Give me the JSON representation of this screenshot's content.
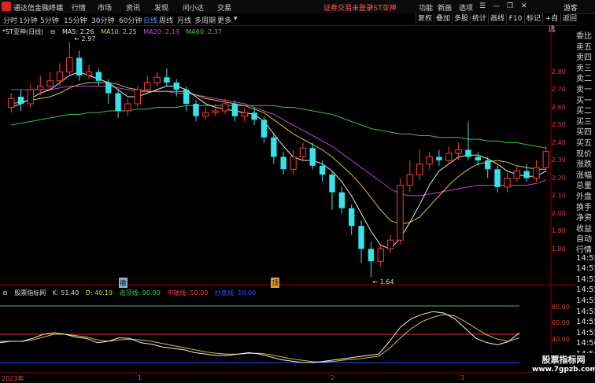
{
  "menubar": {
    "app_name": "通达信金融终端",
    "menus": [
      "行情",
      "市场",
      "资讯",
      "发现",
      "问小达",
      "交易"
    ],
    "warning": "证券交易未登录",
    "stock_tag": "*ST亚神",
    "right_menus": [
      "功能",
      "新画",
      "选项"
    ],
    "guest": "游客"
  },
  "periods": [
    "分时",
    "1分钟",
    "5分钟",
    "15分钟",
    "30分钟",
    "60分钟",
    "日线",
    "周线",
    "月线",
    "多周期",
    "更多"
  ],
  "active_period": "日线",
  "toolbar": [
    "复权",
    "叠加",
    "多股",
    "统计",
    "画线",
    "F10",
    "标记",
    "+自选",
    "返回"
  ],
  "main_chart": {
    "title": "*ST亚神(日线)",
    "ma5": "MA5: 2.26",
    "ma10": "MA10: 2.25",
    "ma20": "MA20: 2.19",
    "ma60": "MA60: 2.37",
    "high_label": "2.97",
    "low_label": "1.64",
    "signal_labels": [
      "撤",
      "顶"
    ]
  },
  "indicator": {
    "name": "股票指标网",
    "k": "K: 51.40",
    "d": "D: 40.19",
    "line1": "逃顶线: 90.00",
    "line2": "中轴线: 50.00",
    "line3": "抄底线: 10.00",
    "y_ticks": [
      "80.00",
      "60.00",
      "40.00"
    ]
  },
  "x_axis": [
    "2023年",
    "1",
    "2",
    "3"
  ],
  "side_panel": [
    "委比",
    "卖五",
    "卖四",
    "卖三",
    "卖二",
    "卖一",
    "买一",
    "买二",
    "买三",
    "买四",
    "买五",
    "现价",
    "涨跌",
    "涨幅",
    "总量",
    "外盘",
    "换手",
    "净资",
    "收益",
    "自动",
    "行情",
    "14:55",
    "14:55",
    "14:55",
    "14:55",
    "14:55",
    "14:55",
    "14:55",
    "14:55",
    "14:56",
    "14:56",
    "14:56",
    "14:56"
  ],
  "watermark": {
    "line1": "股票指标网",
    "line2": "www.7gpzb.com"
  },
  "chart_data": {
    "type": "candlestick",
    "y_ticks": [
      2.8,
      2.7,
      2.6,
      2.5,
      2.4,
      2.3,
      2.2,
      2.1,
      2.0,
      1.9,
      1.8
    ],
    "ylim": [
      1.62,
      3.02
    ],
    "candles": [
      [
        2.6,
        2.65,
        2.68,
        2.57
      ],
      [
        2.66,
        2.62,
        2.7,
        2.58
      ],
      [
        2.62,
        2.7,
        2.73,
        2.6
      ],
      [
        2.7,
        2.72,
        2.78,
        2.67
      ],
      [
        2.72,
        2.75,
        2.8,
        2.7
      ],
      [
        2.75,
        2.8,
        2.85,
        2.72
      ],
      [
        2.8,
        2.88,
        2.97,
        2.78
      ],
      [
        2.88,
        2.78,
        2.92,
        2.75
      ],
      [
        2.78,
        2.8,
        2.84,
        2.76
      ],
      [
        2.8,
        2.75,
        2.82,
        2.72
      ],
      [
        2.74,
        2.68,
        2.76,
        2.62
      ],
      [
        2.68,
        2.58,
        2.7,
        2.54
      ],
      [
        2.58,
        2.62,
        2.65,
        2.55
      ],
      [
        2.62,
        2.7,
        2.72,
        2.6
      ],
      [
        2.7,
        2.74,
        2.78,
        2.68
      ],
      [
        2.74,
        2.77,
        2.8,
        2.72
      ],
      [
        2.77,
        2.74,
        2.82,
        2.72
      ],
      [
        2.74,
        2.7,
        2.76,
        2.66
      ],
      [
        2.7,
        2.62,
        2.72,
        2.58
      ],
      [
        2.62,
        2.55,
        2.64,
        2.52
      ],
      [
        2.55,
        2.57,
        2.6,
        2.53
      ],
      [
        2.57,
        2.58,
        2.62,
        2.55
      ],
      [
        2.58,
        2.62,
        2.65,
        2.56
      ],
      [
        2.62,
        2.55,
        2.64,
        2.52
      ],
      [
        2.55,
        2.57,
        2.6,
        2.52
      ],
      [
        2.57,
        2.53,
        2.6,
        2.5
      ],
      [
        2.53,
        2.43,
        2.55,
        2.4
      ],
      [
        2.43,
        2.32,
        2.45,
        2.28
      ],
      [
        2.32,
        2.25,
        2.35,
        2.22
      ],
      [
        2.25,
        2.32,
        2.36,
        2.22
      ],
      [
        2.32,
        2.37,
        2.4,
        2.3
      ],
      [
        2.37,
        2.27,
        2.4,
        2.25
      ],
      [
        2.27,
        2.22,
        2.3,
        2.18
      ],
      [
        2.22,
        2.12,
        2.24,
        2.02
      ],
      [
        2.12,
        2.03,
        2.15,
        2.0
      ],
      [
        2.03,
        1.93,
        2.05,
        1.88
      ],
      [
        1.93,
        1.8,
        1.96,
        1.72
      ],
      [
        1.8,
        1.73,
        1.84,
        1.64
      ],
      [
        1.73,
        1.8,
        1.83,
        1.7
      ],
      [
        1.8,
        1.85,
        1.88,
        1.78
      ],
      [
        1.85,
        2.16,
        2.2,
        1.83
      ],
      [
        2.16,
        2.22,
        2.3,
        2.12
      ],
      [
        2.22,
        2.28,
        2.36,
        2.19
      ],
      [
        2.28,
        2.32,
        2.35,
        2.25
      ],
      [
        2.32,
        2.3,
        2.36,
        2.27
      ],
      [
        2.3,
        2.34,
        2.38,
        2.28
      ],
      [
        2.34,
        2.36,
        2.4,
        2.3
      ],
      [
        2.36,
        2.32,
        2.52,
        2.3
      ],
      [
        2.32,
        2.3,
        2.35,
        2.27
      ],
      [
        2.3,
        2.25,
        2.32,
        2.2
      ],
      [
        2.25,
        2.15,
        2.27,
        2.12
      ],
      [
        2.15,
        2.2,
        2.23,
        2.12
      ],
      [
        2.2,
        2.24,
        2.27,
        2.18
      ],
      [
        2.24,
        2.2,
        2.28,
        2.18
      ],
      [
        2.2,
        2.26,
        2.3,
        2.18
      ],
      [
        2.26,
        2.35,
        2.38,
        2.24
      ]
    ],
    "ma5": [
      2.6,
      2.62,
      2.65,
      2.68,
      2.7,
      2.74,
      2.78,
      2.8,
      2.78,
      2.76,
      2.74,
      2.7,
      2.66,
      2.66,
      2.68,
      2.7,
      2.72,
      2.72,
      2.7,
      2.66,
      2.62,
      2.6,
      2.59,
      2.58,
      2.57,
      2.56,
      2.52,
      2.45,
      2.38,
      2.32,
      2.3,
      2.3,
      2.28,
      2.24,
      2.18,
      2.1,
      2.0,
      1.9,
      1.82,
      1.8,
      1.86,
      1.95,
      2.05,
      2.16,
      2.24,
      2.28,
      2.32,
      2.33,
      2.33,
      2.31,
      2.28,
      2.24,
      2.22,
      2.21,
      2.21,
      2.24
    ],
    "ma10": [
      2.62,
      2.63,
      2.64,
      2.65,
      2.66,
      2.68,
      2.71,
      2.73,
      2.74,
      2.74,
      2.74,
      2.73,
      2.71,
      2.7,
      2.69,
      2.69,
      2.69,
      2.69,
      2.69,
      2.67,
      2.65,
      2.64,
      2.63,
      2.62,
      2.61,
      2.59,
      2.57,
      2.53,
      2.49,
      2.45,
      2.42,
      2.39,
      2.36,
      2.32,
      2.27,
      2.22,
      2.16,
      2.09,
      2.02,
      1.96,
      1.94,
      1.95,
      1.98,
      2.04,
      2.1,
      2.16,
      2.21,
      2.25,
      2.28,
      2.29,
      2.3,
      2.29,
      2.27,
      2.26,
      2.25,
      2.25
    ],
    "ma20": [
      2.7,
      2.7,
      2.7,
      2.7,
      2.7,
      2.71,
      2.72,
      2.72,
      2.72,
      2.72,
      2.72,
      2.71,
      2.7,
      2.69,
      2.69,
      2.69,
      2.69,
      2.68,
      2.68,
      2.67,
      2.66,
      2.65,
      2.64,
      2.63,
      2.62,
      2.6,
      2.58,
      2.56,
      2.53,
      2.5,
      2.47,
      2.44,
      2.41,
      2.38,
      2.34,
      2.3,
      2.26,
      2.22,
      2.18,
      2.14,
      2.11,
      2.1,
      2.1,
      2.11,
      2.12,
      2.13,
      2.14,
      2.15,
      2.16,
      2.16,
      2.16,
      2.16,
      2.16,
      2.16,
      2.17,
      2.19
    ],
    "ma60": [
      2.5,
      2.51,
      2.52,
      2.53,
      2.54,
      2.55,
      2.56,
      2.56,
      2.57,
      2.57,
      2.58,
      2.58,
      2.58,
      2.59,
      2.59,
      2.6,
      2.6,
      2.6,
      2.61,
      2.61,
      2.61,
      2.61,
      2.61,
      2.61,
      2.61,
      2.61,
      2.61,
      2.61,
      2.6,
      2.6,
      2.59,
      2.58,
      2.57,
      2.56,
      2.54,
      2.52,
      2.5,
      2.48,
      2.47,
      2.46,
      2.45,
      2.45,
      2.44,
      2.44,
      2.43,
      2.43,
      2.43,
      2.42,
      2.42,
      2.41,
      2.41,
      2.4,
      2.4,
      2.39,
      2.38,
      2.37
    ],
    "k": [
      38,
      40,
      40,
      44,
      50,
      52,
      50,
      46,
      44,
      38,
      40,
      45,
      44,
      38,
      36,
      32,
      30,
      28,
      24,
      22,
      20,
      20,
      22,
      24,
      22,
      18,
      14,
      12,
      10,
      10,
      12,
      14,
      16,
      18,
      20,
      22,
      40,
      60,
      72,
      78,
      82,
      80,
      72,
      58,
      44,
      38,
      35,
      40,
      52
    ],
    "d": [
      40,
      40,
      40,
      42,
      46,
      50,
      50,
      48,
      46,
      42,
      40,
      42,
      43,
      42,
      40,
      37,
      34,
      31,
      28,
      25,
      23,
      22,
      22,
      23,
      23,
      21,
      18,
      15,
      13,
      11,
      11,
      12,
      14,
      15,
      17,
      19,
      30,
      45,
      58,
      68,
      74,
      78,
      76,
      68,
      58,
      49,
      43,
      40,
      45
    ],
    "ind_ylim": [
      0,
      100
    ],
    "ind_levels": [
      90,
      50,
      10
    ]
  }
}
